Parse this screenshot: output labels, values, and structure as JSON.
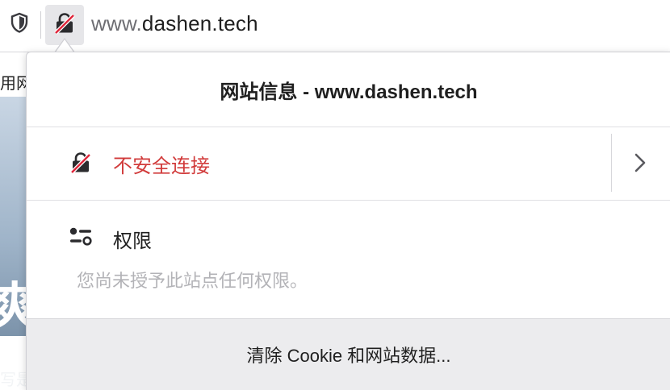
{
  "urlbar": {
    "url_prefix": "www.",
    "url_domain": "dashen.tech",
    "tracking_icon": "shield-icon",
    "identity_icon": "insecure-lock-icon"
  },
  "background_page": {
    "tab_text": "用网",
    "big_glyph": "爽",
    "bottom_text": "写是"
  },
  "panel": {
    "title": "网站信息 - www.dashen.tech",
    "security": {
      "label": "不安全连接",
      "icon": "insecure-lock-icon",
      "color": "#d13b3b"
    },
    "permissions": {
      "title": "权限",
      "description": "您尚未授予此站点任何权限。",
      "icon": "permissions-icon"
    },
    "footer": {
      "clear_label": "清除 Cookie 和网站数据..."
    }
  }
}
